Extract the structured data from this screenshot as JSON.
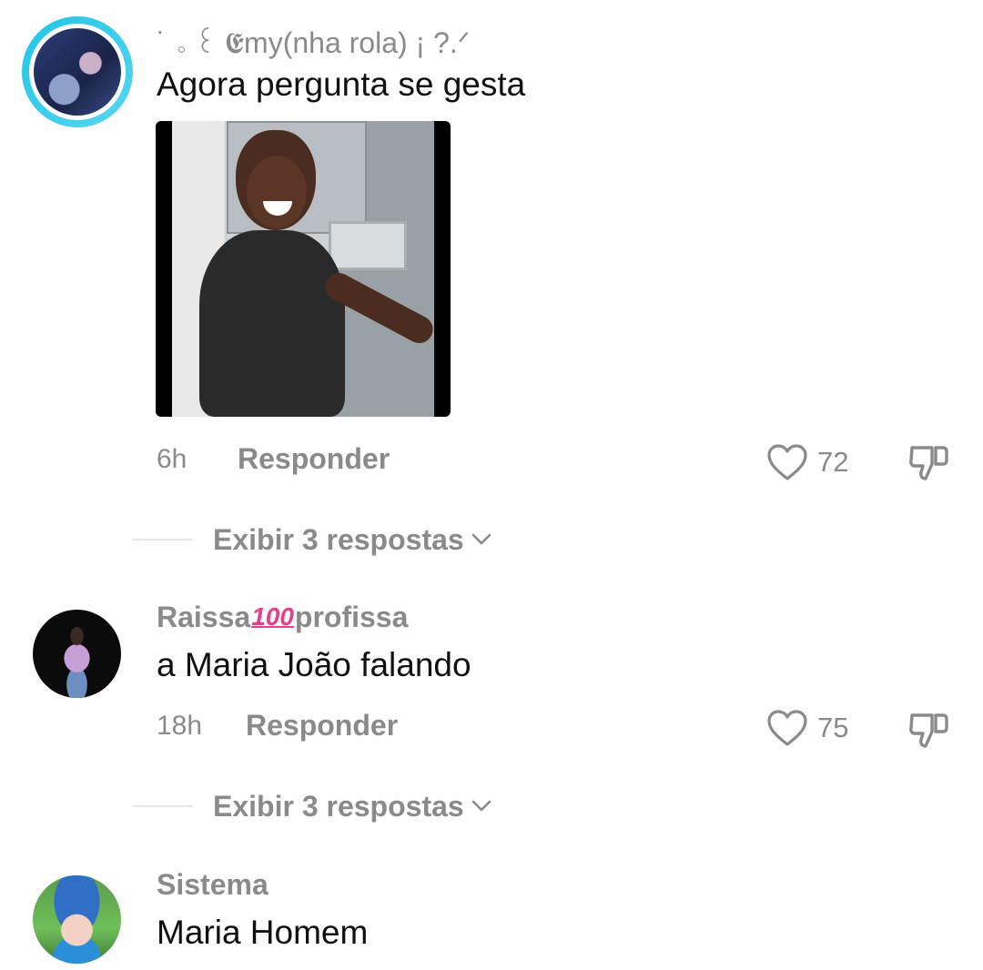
{
  "comments": [
    {
      "username": "˙ ｡ ꒰ 𝕰my(nha rola) ¡ ?.ᐟ",
      "text": "Agora pergunta se gesta",
      "time": "6h",
      "reply_label": "Responder",
      "likes": "72",
      "view_replies": "Exibir 3 respostas"
    },
    {
      "username_before": "Raissa",
      "username_emoji": "100",
      "username_after": "profissa",
      "text": "a Maria João falando",
      "time": "18h",
      "reply_label": "Responder",
      "likes": "75",
      "view_replies": "Exibir 3 respostas"
    },
    {
      "username": "Sistema",
      "text": "Maria Homem"
    }
  ],
  "icons": {
    "like": "heart-outline-icon",
    "dislike": "thumbs-down-outline-icon",
    "expand": "chevron-down-icon"
  },
  "colors": {
    "meta_gray": "#8a8a8a",
    "text": "#111111",
    "avatar_ring": "#21c5e6"
  }
}
